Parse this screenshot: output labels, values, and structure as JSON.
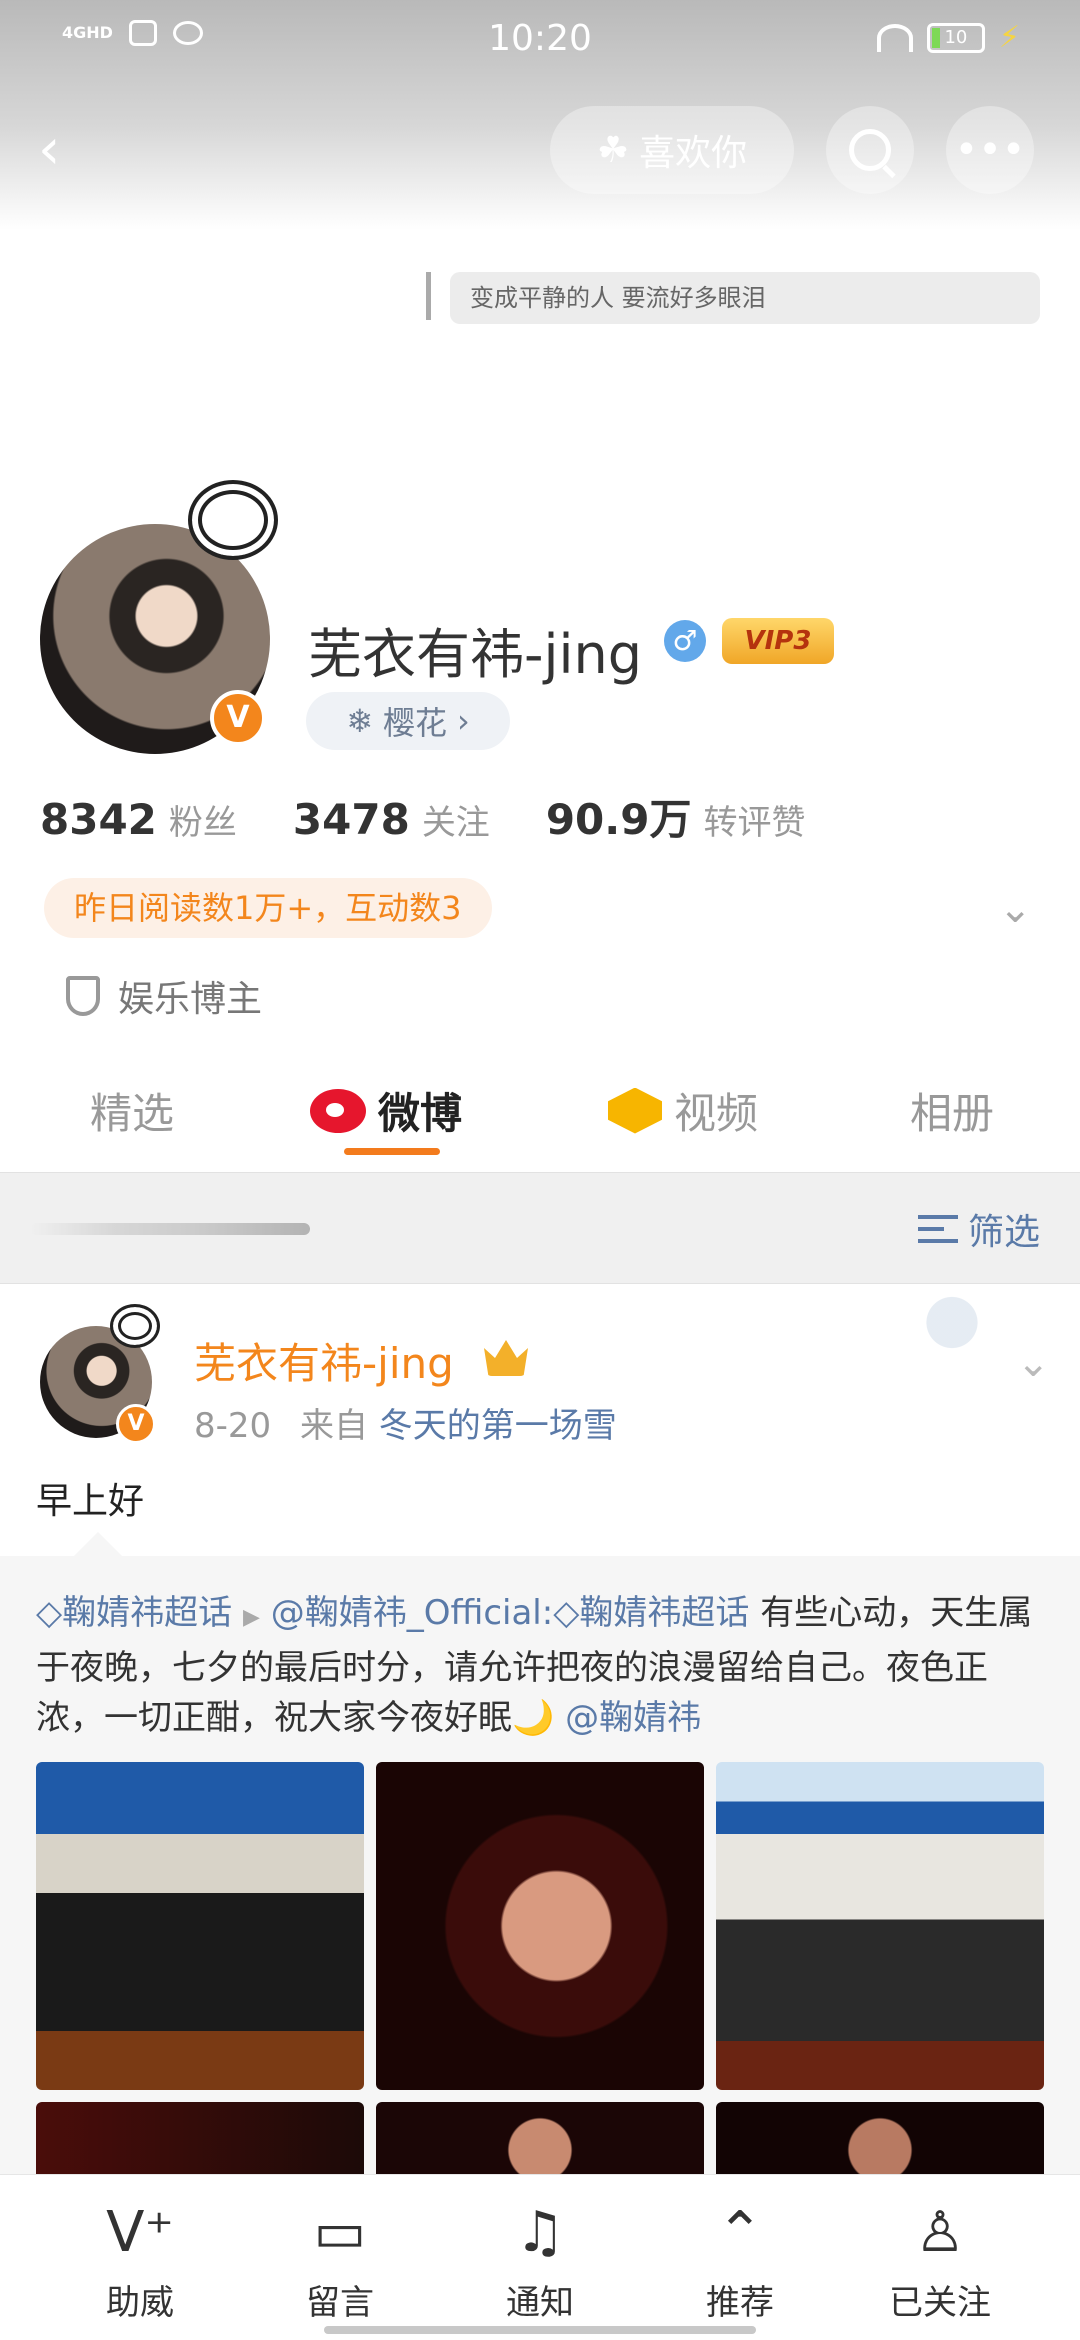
{
  "status_bar": {
    "network": "4GHD",
    "time": "10:20",
    "battery": "10"
  },
  "top_nav": {
    "like_label": "喜欢你",
    "back_icon": "chevron-left-icon",
    "search_icon": "search-icon",
    "more_icon": "more-dots-icon"
  },
  "profile": {
    "bio": "变成平静的人  要流好多眼泪",
    "name": "芜衣有祎-jing",
    "gender": "♂",
    "vip": "VIP3",
    "verified": "V",
    "tag": "樱花",
    "tag_chevron": "›",
    "stats": [
      {
        "value": "8342",
        "label": "粉丝"
      },
      {
        "value": "3478",
        "label": "关注"
      },
      {
        "value": "90.9万",
        "label": "转评赞"
      }
    ],
    "reads": "昨日阅读数1万+，互动数3",
    "role": "娱乐博主",
    "colors": {
      "accent": "#f37b1d",
      "link": "#5a7aa8",
      "verified_badge": "#f3861c"
    }
  },
  "tabs": [
    {
      "label": "精选",
      "active": false
    },
    {
      "label": "微博",
      "active": true
    },
    {
      "label": "视频",
      "active": false
    },
    {
      "label": "相册",
      "active": false
    }
  ],
  "filter": {
    "label": "筛选"
  },
  "post": {
    "author": "芜衣有祎-jing",
    "date": "8-20",
    "from_prefix": "来自",
    "source": "冬天的第一场雪",
    "text": "早上好",
    "repost": {
      "topic1": "鞠婧祎超话",
      "arrow": "▶",
      "mention": "@鞠婧祎_Official",
      "colon": ":",
      "topic2": "鞠婧祎超话",
      "body1": " 有些心动，天生属于夜晚，七夕的最后时分，请允许把夜的浪漫留给自己。夜色正浓，一切正酣，祝大家今夜好眠🌙",
      "mention2": "@鞠婧祎"
    }
  },
  "bottom_bar": [
    {
      "label": "助威",
      "icon": "cheer-v-plus-icon"
    },
    {
      "label": "留言",
      "icon": "message-bubble-icon"
    },
    {
      "label": "通知",
      "icon": "bell-plus-icon"
    },
    {
      "label": "推荐",
      "icon": "chevron-up-circle-icon"
    },
    {
      "label": "已关注",
      "icon": "user-check-icon"
    }
  ]
}
